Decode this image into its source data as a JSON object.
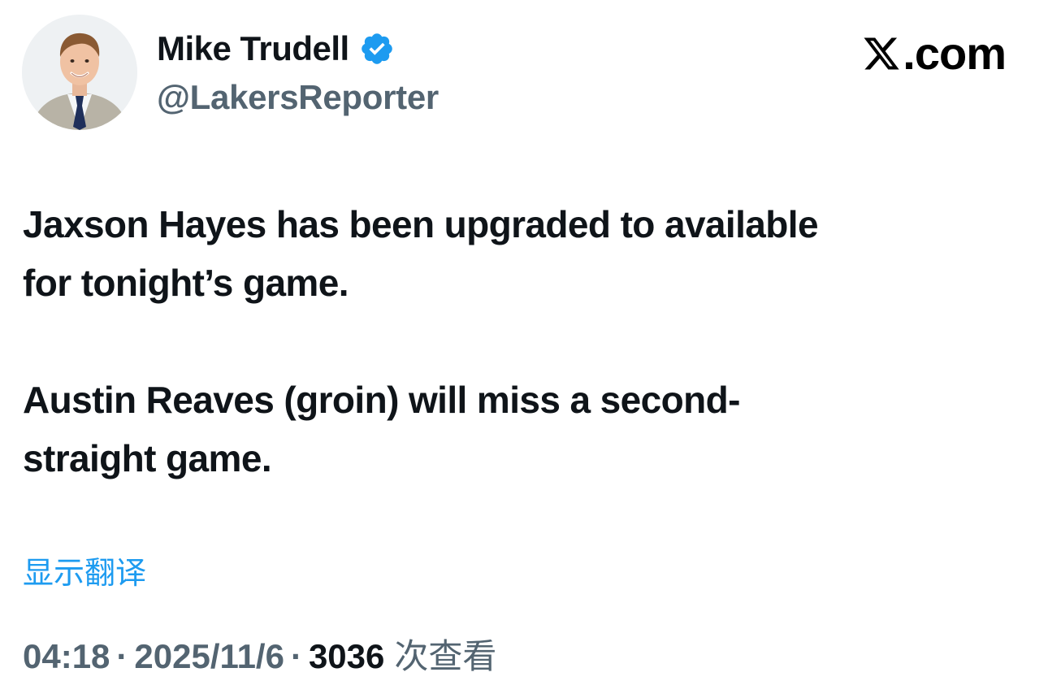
{
  "author": {
    "display_name": "Mike Trudell",
    "handle": "@LakersReporter",
    "verified": true,
    "avatar_icon": "profile-photo"
  },
  "brand": {
    "logo_icon": "x-logo-icon",
    "text": ".com"
  },
  "tweet": {
    "paragraphs": [
      "Jaxson Hayes has been upgraded to available\nfor tonight’s game.",
      "Austin Reaves (groin) will miss a second-\nstraight game."
    ]
  },
  "translate_label": "显示翻译",
  "meta": {
    "time": "04:18",
    "separator": "·",
    "date": "2025/11/6",
    "views_count": "3036",
    "views_label": "次查看"
  },
  "colors": {
    "verified_badge": "#1d9bf0",
    "link": "#1d9bf0",
    "secondary_text": "#536471",
    "primary_text": "#0f1419"
  }
}
